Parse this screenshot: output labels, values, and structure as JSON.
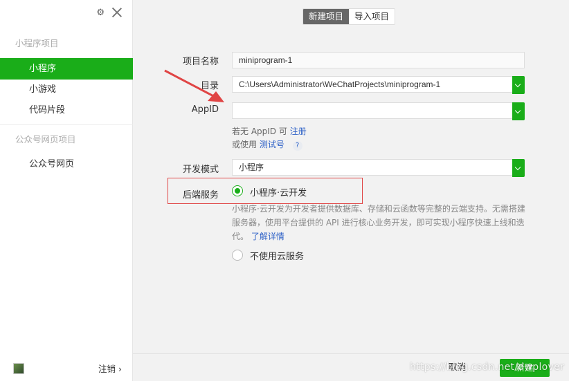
{
  "sidebar": {
    "groups": [
      {
        "title": "小程序项目",
        "items": [
          "小程序",
          "小游戏",
          "代码片段"
        ]
      },
      {
        "title": "公众号网页项目",
        "items": [
          "公众号网页"
        ]
      }
    ],
    "active_item": "小程序",
    "logout_label": "注销 ›"
  },
  "tabs": [
    "新建项目",
    "导入项目"
  ],
  "form": {
    "project_name_label": "项目名称",
    "project_name_value": "miniprogram-1",
    "directory_label": "目录",
    "directory_value": "C:\\Users\\Administrator\\WeChatProjects\\miniprogram-1",
    "appid_label": "AppID",
    "appid_value": "",
    "hint_no_appid": "若无 AppID 可",
    "hint_register": "注册",
    "hint_or_use": "或使用",
    "hint_test_account": "测试号",
    "help_icon": "?",
    "dev_mode_label": "开发模式",
    "dev_mode_value": "小程序",
    "backend_label": "后端服务",
    "backend_option_cloud": "小程序·云开发",
    "backend_desc": "小程序·云开发为开发者提供数据库、存储和云函数等完整的云端支持。无需搭建服务器，使用平台提供的 API 进行核心业务开发，即可实现小程序快速上线和迭代。",
    "learn_more": "了解详情",
    "backend_option_none": "不使用云服务"
  },
  "footer": {
    "cancel_label": "取消",
    "create_label": "新建"
  },
  "watermark": "https://blog.csdn.net/dwplover",
  "colors": {
    "accent": "#1aad19",
    "annotation_red": "#e04545",
    "link": "#2f62c7"
  }
}
